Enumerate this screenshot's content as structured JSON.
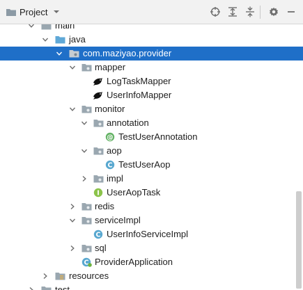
{
  "toolbar": {
    "title": "Project",
    "buttons": [
      "locate-icon",
      "expand-all-icon",
      "collapse-all-icon",
      "settings-icon",
      "hide-icon"
    ]
  },
  "tree": {
    "items": [
      {
        "label": "main",
        "kind": "folder",
        "expanded": true
      },
      {
        "label": "java",
        "kind": "source-folder",
        "expanded": true
      },
      {
        "label": "com.maziyao.provider",
        "kind": "package",
        "expanded": true,
        "selected": true
      },
      {
        "label": "mapper",
        "kind": "package",
        "expanded": true
      },
      {
        "label": "LogTaskMapper",
        "kind": "mybatis-mapper"
      },
      {
        "label": "UserInfoMapper",
        "kind": "mybatis-mapper"
      },
      {
        "label": "monitor",
        "kind": "package",
        "expanded": true
      },
      {
        "label": "annotation",
        "kind": "package",
        "expanded": true
      },
      {
        "label": "TestUserAnnotation",
        "kind": "annotation-class"
      },
      {
        "label": "aop",
        "kind": "package",
        "expanded": true
      },
      {
        "label": "TestUserAop",
        "kind": "class"
      },
      {
        "label": "impl",
        "kind": "package",
        "expanded": false
      },
      {
        "label": "UserAopTask",
        "kind": "interface"
      },
      {
        "label": "redis",
        "kind": "package",
        "expanded": false
      },
      {
        "label": "serviceImpl",
        "kind": "package",
        "expanded": true
      },
      {
        "label": "UserInfoServiceImpl",
        "kind": "class"
      },
      {
        "label": "sql",
        "kind": "package",
        "expanded": false
      },
      {
        "label": "ProviderApplication",
        "kind": "spring-boot-class"
      },
      {
        "label": "resources",
        "kind": "resource-folder",
        "expanded": false
      },
      {
        "label": "test",
        "kind": "folder",
        "expanded": false
      }
    ]
  },
  "colors": {
    "selection": "#1f6fc8",
    "class_icon": "#59a8d0",
    "annotation_icon": "#63b264",
    "interface_icon": "#8bc34a",
    "folder": "#9aa7b0",
    "source_folder": "#5fa8d7"
  }
}
